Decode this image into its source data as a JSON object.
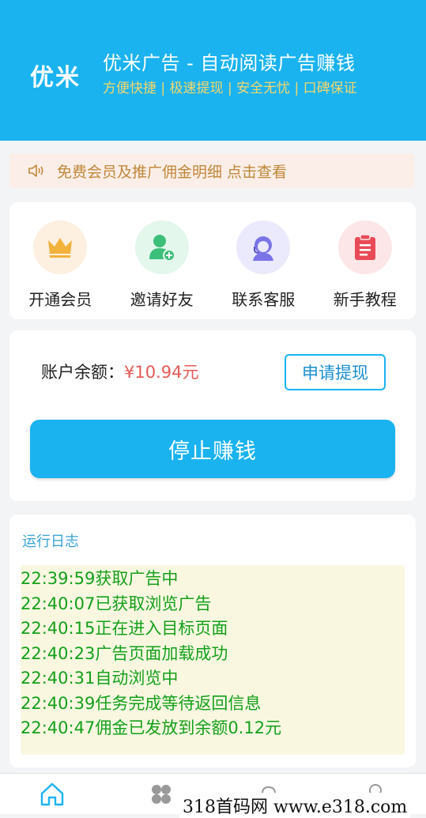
{
  "header": {
    "logo": "优米",
    "title": "优米广告 - 自动阅读广告赚钱",
    "subtitle": "方便快捷 | 极速提现 | 安全无忧 | 口碑保证"
  },
  "notice": {
    "text": "免费会员及推广佣金明细 点击查看",
    "icon": "speaker-icon"
  },
  "menu": {
    "items": [
      {
        "label": "开通会员",
        "icon": "crown-icon",
        "color": "#f3b23b",
        "bg": "#fdf0e0"
      },
      {
        "label": "邀请好友",
        "icon": "add-user-icon",
        "color": "#3cbf7a",
        "bg": "#e3f7ec"
      },
      {
        "label": "联系客服",
        "icon": "customer-service-icon",
        "color": "#7b73e8",
        "bg": "#ebeafc"
      },
      {
        "label": "新手教程",
        "icon": "clipboard-icon",
        "color": "#e84a57",
        "bg": "#fde6e7"
      }
    ]
  },
  "account": {
    "label": "账户余额：",
    "balance": "¥10.94元",
    "withdraw_label": "申请提现",
    "stop_label": "停止赚钱"
  },
  "log": {
    "title": "运行日志",
    "lines": [
      "22:39:59获取广告中",
      "22:40:07已获取浏览广告",
      "22:40:15正在进入目标页面",
      "22:40:23广告页面加载成功",
      "22:40:31自动浏览中",
      "22:40:39任务完成等待返回信息",
      "22:40:47佣金已发放到余额0.12元"
    ]
  },
  "tabbar": {
    "tabs": [
      "home-icon",
      "apps-icon",
      "bell-icon",
      "user-icon"
    ]
  },
  "watermark": "318首码网   www.e318.com",
  "colors": {
    "primary": "#1ab3f0",
    "balance": "#e35a55",
    "log_text": "#14a01a",
    "notice_text": "#c1873a"
  }
}
